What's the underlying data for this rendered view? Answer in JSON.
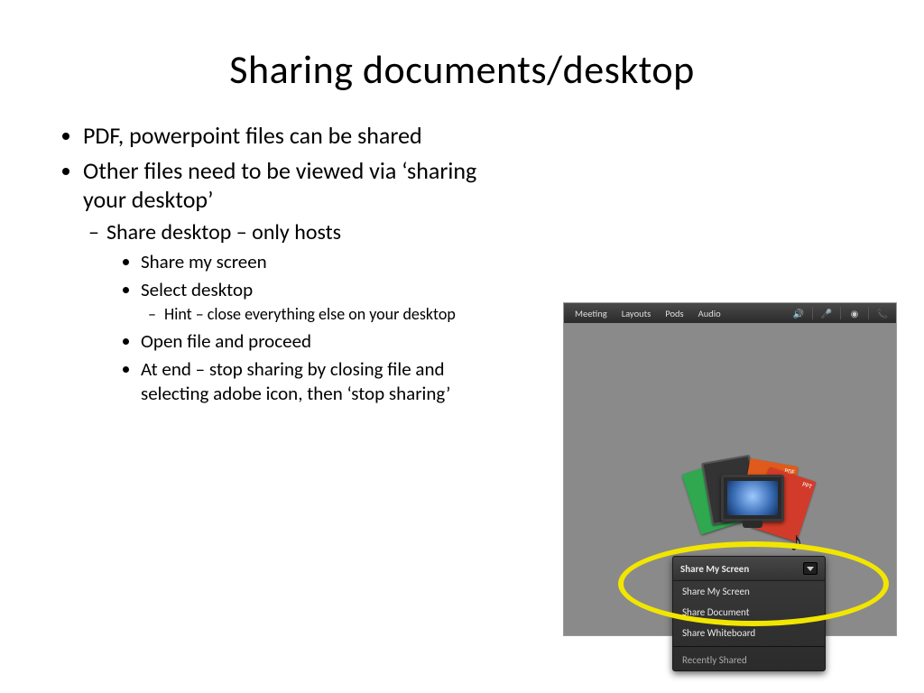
{
  "title": "Sharing documents/desktop",
  "bullets": {
    "b1": "PDF, powerpoint files can be shared",
    "b2": "Other files need to be viewed via ‘sharing your desktop’",
    "b2_1": "Share desktop – only hosts",
    "b2_1_1": "Share my screen",
    "b2_1_2": "Select desktop",
    "b2_1_2_1": "Hint – close everything else on your desktop",
    "b2_1_3": "Open file and proceed",
    "b2_1_4": "At end – stop sharing by closing file and selecting adobe icon, then ‘stop sharing’"
  },
  "screenshot": {
    "menus": {
      "m1": "Meeting",
      "m2": "Layouts",
      "m3": "Pods",
      "m4": "Audio"
    },
    "dropdown": {
      "header": "Share My Screen",
      "opt1": "Share My Screen",
      "opt2": "Share Document",
      "opt3": "Share Whiteboard",
      "opt4": "Recently Shared"
    }
  }
}
